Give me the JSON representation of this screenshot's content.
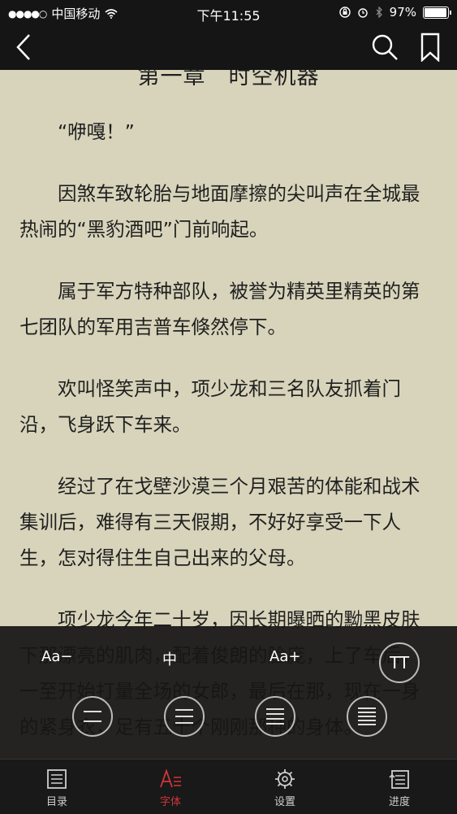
{
  "status_bar": {
    "carrier": "中国移动",
    "time": "下午11:55",
    "battery": "97%",
    "battery_level": 0.97
  },
  "nav": {
    "back_icon": "chevron-left-icon",
    "search_icon": "search-icon",
    "bookmark_icon": "bookmark-icon"
  },
  "chapter": {
    "title": "第一章　时空机器",
    "paragraphs": [
      "“咿嘎！”",
      "因煞车致轮胎与地面摩擦的尖叫声在全城最热闹的“黑豹酒吧”门前响起。",
      "属于军方特种部队，被誉为精英里精英的第七团队的军用吉普车倏然停下。",
      "欢叫怪笑声中，项少龙和三名队友抓着门沿，飞身跃下车来。",
      "经过了在戈壁沙漠三个月艰苦的体能和战术集训后，难得有三天假期，不好好享受一下人生，怎对得住生自己出来的父母。",
      "项少龙今年二十岁，因长期曝晒的黝黑皮肤下那漂亮的肌肉，配着俊朗的脸庞，上了车后，一至开始打量全场的女郎，最后在那，现在一身的紧身衣，足有五十个刚刚那种的身体。"
    ]
  },
  "font_panel": {
    "font_smaller": "Aa−",
    "font_medium": "中",
    "font_larger": "Aa+",
    "typeface_label": "TT",
    "line_spacing_selected": 3,
    "accent_color": "#d2353a"
  },
  "tabs": [
    {
      "label": "目录",
      "icon": "list-icon",
      "active": false
    },
    {
      "label": "字体",
      "icon": "font-icon",
      "active": true
    },
    {
      "label": "设置",
      "icon": "gear-icon",
      "active": false
    },
    {
      "label": "进度",
      "icon": "progress-icon",
      "active": false
    }
  ]
}
